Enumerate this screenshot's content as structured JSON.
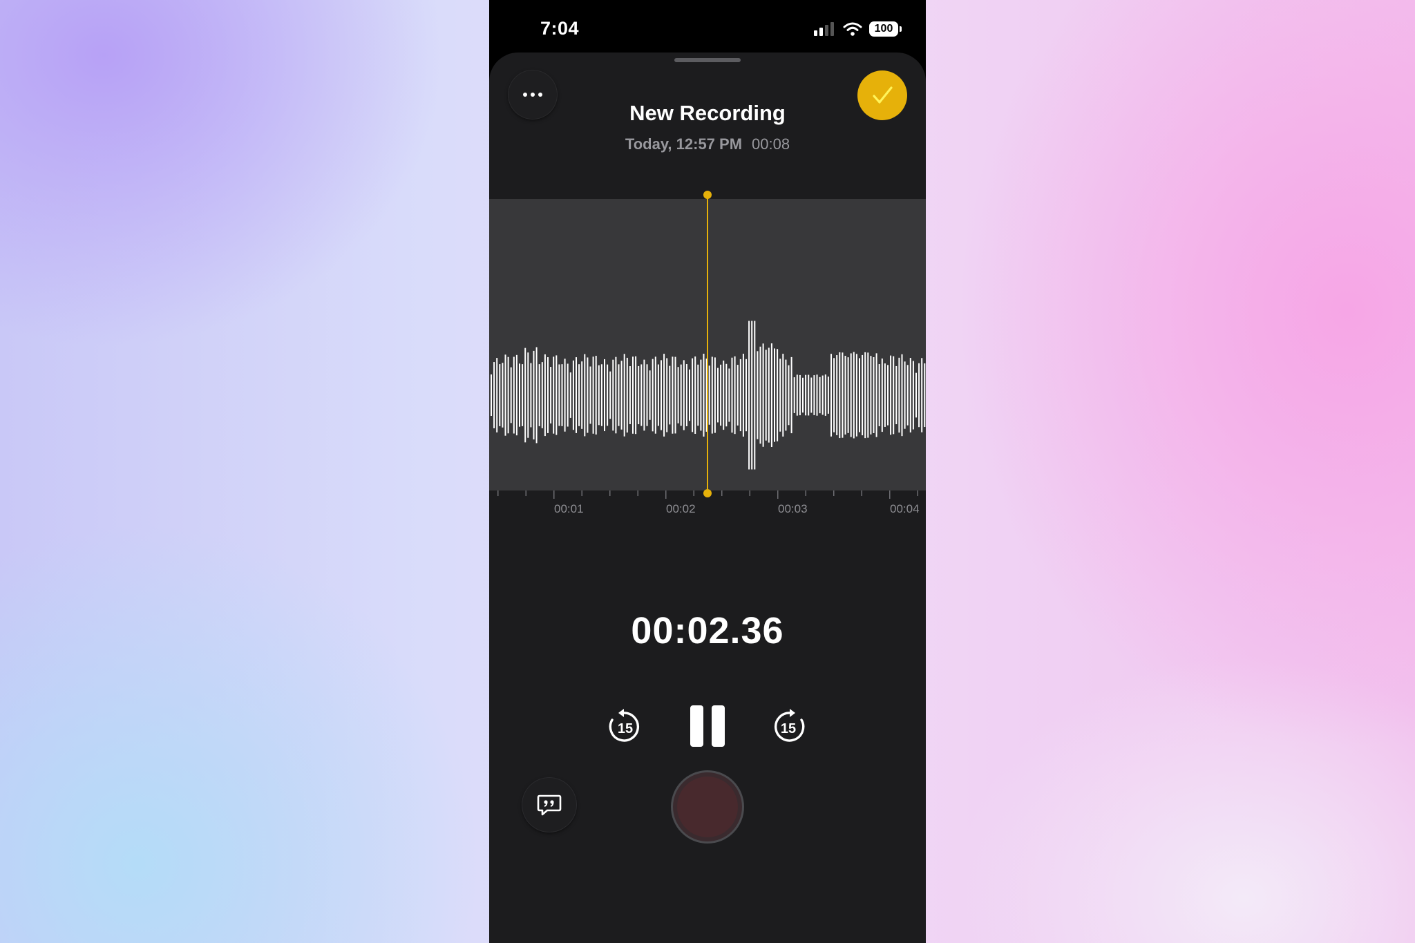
{
  "status_bar": {
    "time": "7:04",
    "battery": "100"
  },
  "recording": {
    "title": "New Recording",
    "date": "Today, 12:57 PM",
    "duration": "00:08",
    "elapsed": "00:02.36"
  },
  "timeline": {
    "labels": [
      "00:01",
      "00:02",
      "00:03",
      "00:04"
    ]
  },
  "controls": {
    "skip_back": "15",
    "skip_forward": "15"
  },
  "colors": {
    "accent": "#e6b10a",
    "background": "#1c1c1e",
    "waveform": "#ffffff"
  },
  "icons": {
    "more": "more-dots-icon",
    "done": "checkmark-icon",
    "skip_back": "skip-back-15-icon",
    "pause": "pause-icon",
    "skip_forward": "skip-forward-15-icon",
    "transcript": "quote-bubble-icon"
  }
}
